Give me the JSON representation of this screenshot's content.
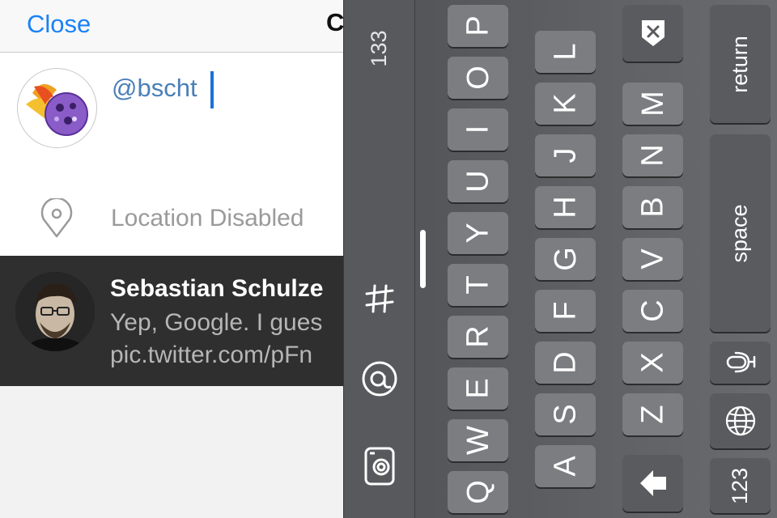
{
  "topbar": {
    "close_label": "Close",
    "title_peek": "C"
  },
  "compose": {
    "text": "@bscht",
    "location_label": "Location Disabled"
  },
  "reply": {
    "name": "Sebastian Schulze",
    "line1": "Yep, Google. I gues",
    "line2": "pic.twitter.com/pFn"
  },
  "keyboard": {
    "char_count": "133",
    "icons": {
      "hash": "#",
      "at": "@"
    },
    "row_top": [
      "Q",
      "W",
      "E",
      "R",
      "T",
      "Y",
      "U",
      "I",
      "O",
      "P"
    ],
    "row_mid": [
      "A",
      "S",
      "D",
      "F",
      "G",
      "H",
      "J",
      "K",
      "L"
    ],
    "row_bottom": [
      "Z",
      "X",
      "C",
      "V",
      "B",
      "N",
      "M"
    ],
    "return_label": "return",
    "space_label": "space",
    "numbers_label": "123",
    "icon_names": [
      "delete-icon",
      "shift-icon",
      "microphone-icon",
      "globe-icon",
      "camera-icon",
      "hash-icon",
      "at-icon"
    ]
  },
  "colors": {
    "accent": "#1a82f5",
    "handle_text": "#4a7fb8",
    "reply_bg": "#2f2f2f"
  }
}
